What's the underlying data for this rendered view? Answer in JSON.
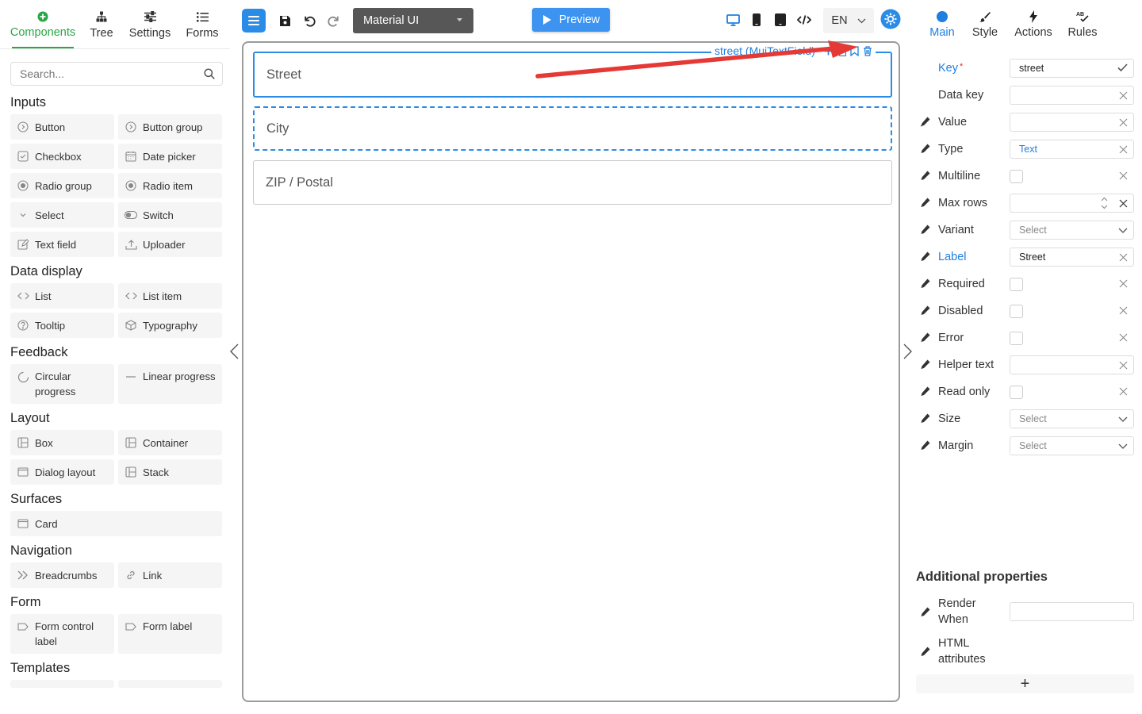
{
  "left": {
    "tabs": [
      {
        "label": "Components",
        "icon": "plus-circle-icon",
        "active": true
      },
      {
        "label": "Tree",
        "icon": "tree-icon"
      },
      {
        "label": "Settings",
        "icon": "sliders-icon"
      },
      {
        "label": "Forms",
        "icon": "list-icon"
      }
    ],
    "search_placeholder": "Search...",
    "categories": [
      {
        "name": "Inputs",
        "items": [
          "Button",
          "Button group",
          "Checkbox",
          "Date picker",
          "Radio group",
          "Radio item",
          "Select",
          "Switch",
          "Text field",
          "Uploader"
        ]
      },
      {
        "name": "Data display",
        "items": [
          "List",
          "List item",
          "Tooltip",
          "Typography"
        ]
      },
      {
        "name": "Feedback",
        "items": [
          "Circular progress",
          "Linear progress"
        ]
      },
      {
        "name": "Layout",
        "items": [
          "Box",
          "Container",
          "Dialog layout",
          "Stack"
        ]
      },
      {
        "name": "Surfaces",
        "items": [
          "Card"
        ]
      },
      {
        "name": "Navigation",
        "items": [
          "Breadcrumbs",
          "Link"
        ]
      },
      {
        "name": "Form",
        "items": [
          "Form control label",
          "Form label"
        ]
      },
      {
        "name": "Templates",
        "items": []
      }
    ]
  },
  "toolbar": {
    "theme": "Material UI",
    "preview": "Preview",
    "language": "EN"
  },
  "canvas": {
    "fields": [
      "Street",
      "City",
      "ZIP / Postal"
    ],
    "selected_tag": "street (MuiTextField)"
  },
  "right": {
    "tabs": [
      {
        "label": "Main",
        "active": true
      },
      {
        "label": "Style"
      },
      {
        "label": "Actions"
      },
      {
        "label": "Rules"
      }
    ],
    "props": {
      "key": {
        "label": "Key",
        "value": "street"
      },
      "data_key": {
        "label": "Data key",
        "value": ""
      },
      "value": {
        "label": "Value",
        "value": ""
      },
      "type": {
        "label": "Type",
        "value": "Text"
      },
      "multiline": {
        "label": "Multiline"
      },
      "max_rows": {
        "label": "Max rows",
        "value": ""
      },
      "variant": {
        "label": "Variant",
        "value": "Select"
      },
      "label": {
        "label": "Label",
        "value": "Street"
      },
      "required": {
        "label": "Required"
      },
      "disabled": {
        "label": "Disabled"
      },
      "error": {
        "label": "Error"
      },
      "helper_text": {
        "label": "Helper text",
        "value": ""
      },
      "read_only": {
        "label": "Read only"
      },
      "size": {
        "label": "Size",
        "value": "Select"
      },
      "margin": {
        "label": "Margin",
        "value": "Select"
      }
    },
    "additional_title": "Additional properties",
    "render_when": "Render When",
    "html_attributes": "HTML attributes",
    "add_symbol": "+"
  },
  "colors": {
    "accent_blue": "#2b8ce8",
    "active_green": "#28a745",
    "annotation_red": "#e53935"
  }
}
